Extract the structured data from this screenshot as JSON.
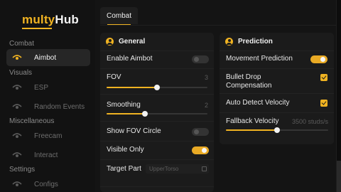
{
  "app": {
    "logo_accent": "multy",
    "logo_rest": "Hub"
  },
  "colors": {
    "accent": "#f0b322",
    "bg": "#141414",
    "panel": "#1b1b1b"
  },
  "sidebar": {
    "sections": [
      {
        "title": "Combat",
        "items": [
          {
            "label": "Aimbot",
            "icon": "eye-icon",
            "active": true
          }
        ]
      },
      {
        "title": "Visuals",
        "items": [
          {
            "label": "ESP",
            "icon": "eye-icon"
          },
          {
            "label": "Random Events",
            "icon": "eye-icon"
          }
        ]
      },
      {
        "title": "Miscellaneous",
        "items": [
          {
            "label": "Freecam",
            "icon": "eye-icon"
          },
          {
            "label": "Interact",
            "icon": "eye-icon"
          }
        ]
      },
      {
        "title": "Settings",
        "items": [
          {
            "label": "Configs",
            "icon": "eye-icon"
          }
        ]
      }
    ]
  },
  "header": {
    "tab": "Combat"
  },
  "general": {
    "title": "General",
    "enable_aimbot": {
      "label": "Enable Aimbot",
      "on": false
    },
    "fov": {
      "label": "FOV",
      "value": "3",
      "fill": 0.5
    },
    "smoothing": {
      "label": "Smoothing",
      "value": "2",
      "fill": 0.38
    },
    "show_fov_circle": {
      "label": "Show FOV Circle",
      "on": false
    },
    "visible_only": {
      "label": "Visible Only",
      "on": true
    },
    "target_part": {
      "label": "Target Part",
      "value": "UpperTorso"
    }
  },
  "prediction": {
    "title": "Prediction",
    "movement_prediction": {
      "label": "Movement Prediction",
      "on": true
    },
    "bullet_drop": {
      "label": "Bullet Drop Compensation",
      "checked": true
    },
    "auto_detect": {
      "label": "Auto Detect Velocity",
      "checked": true
    },
    "fallback_velocity": {
      "label": "Fallback Velocity",
      "value": "3500 studs/s",
      "fill": 0.5
    }
  }
}
